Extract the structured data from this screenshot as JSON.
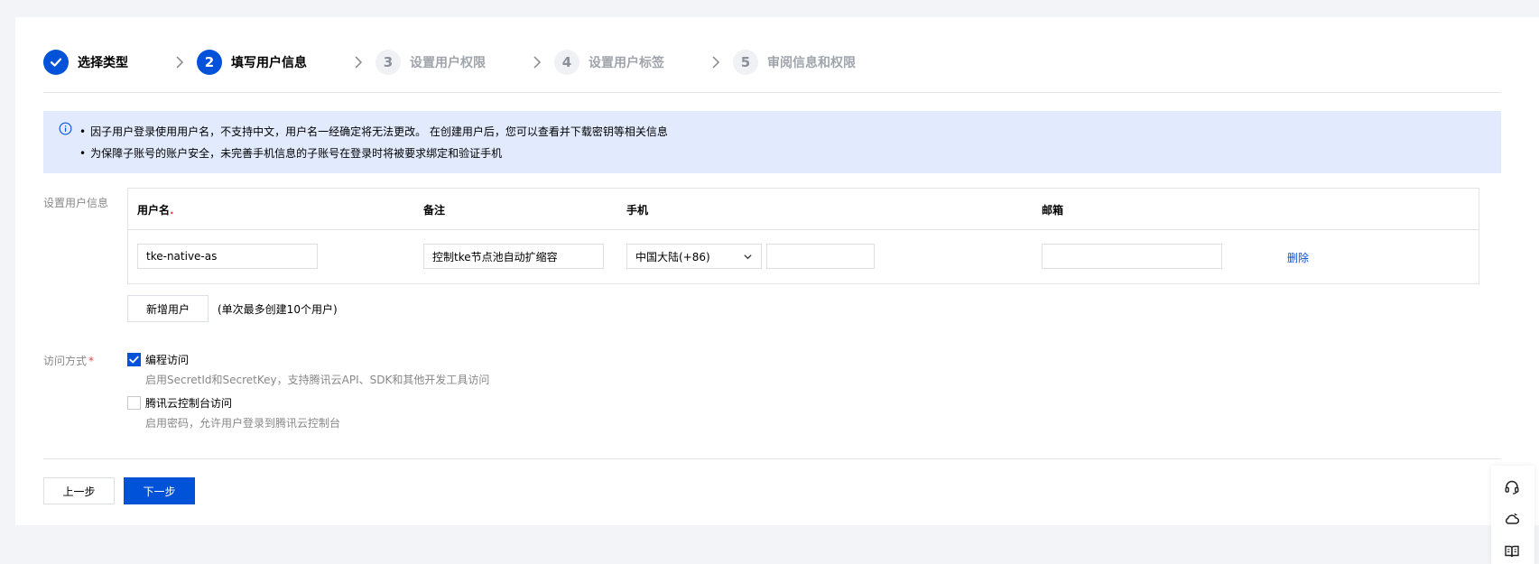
{
  "steps": [
    {
      "num": "1",
      "label": "选择类型",
      "state": "done"
    },
    {
      "num": "2",
      "label": "填写用户信息",
      "state": "active"
    },
    {
      "num": "3",
      "label": "设置用户权限",
      "state": "todo"
    },
    {
      "num": "4",
      "label": "设置用户标签",
      "state": "todo"
    },
    {
      "num": "5",
      "label": "审阅信息和权限",
      "state": "todo"
    }
  ],
  "banner": {
    "line1": "因子用户登录使用用户名，不支持中文，用户名一经确定将无法更改。 在创建用户后，您可以查看并下载密钥等相关信息",
    "line2": "为保障子账号的账户安全，未完善手机信息的子账号在登录时将被要求绑定和验证手机"
  },
  "user_section": {
    "label": "设置用户信息",
    "columns": {
      "username": "用户名",
      "remark": "备注",
      "phone": "手机",
      "email": "邮箱"
    },
    "row": {
      "username": "tke-native-as",
      "remark": "控制tke节点池自动扩缩容",
      "country": "中国大陆(+86)",
      "phone": "",
      "email": "",
      "delete_label": "删除"
    },
    "add_button": "新增用户",
    "add_hint": "(单次最多创建10个用户)"
  },
  "access": {
    "label": "访问方式",
    "options": [
      {
        "title": "编程访问",
        "desc": "启用SecretId和SecretKey，支持腾讯云API、SDK和其他开发工具访问",
        "checked": true
      },
      {
        "title": "腾讯云控制台访问",
        "desc": "启用密码，允许用户登录到腾讯云控制台",
        "checked": false
      }
    ]
  },
  "footer": {
    "prev": "上一步",
    "next": "下一步"
  },
  "float_icons": [
    "headset-icon",
    "cloud-icon",
    "book-icon"
  ],
  "colors": {
    "primary": "#0052d9",
    "banner_bg": "#e2ebfd",
    "required": "#e54545"
  }
}
